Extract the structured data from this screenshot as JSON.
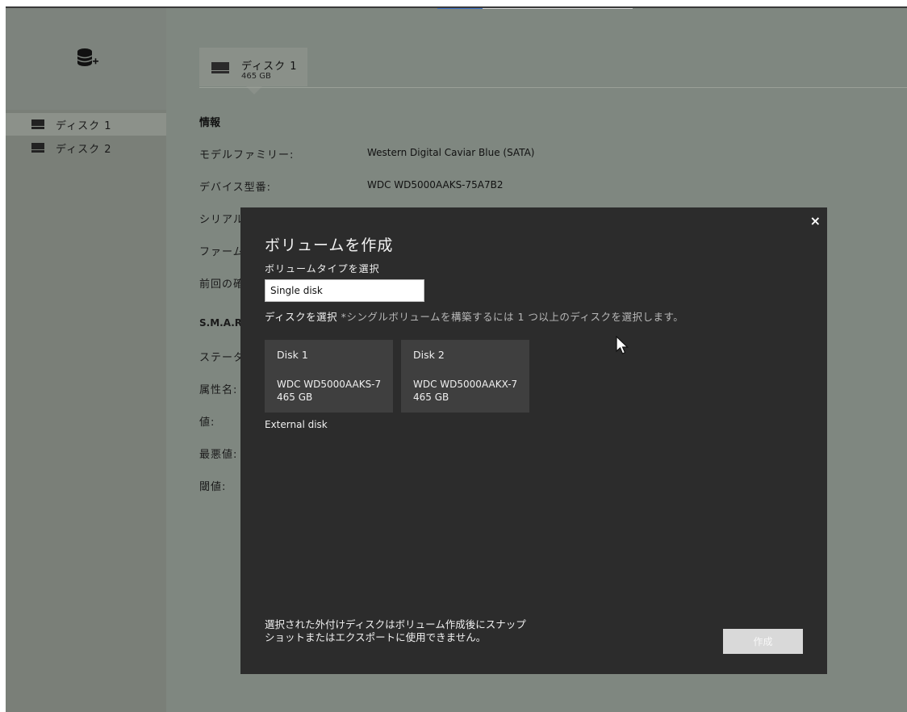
{
  "sidebar": {
    "add_icon": "database-add-icon",
    "items": [
      {
        "label": "ディスク 1",
        "active": true
      },
      {
        "label": "ディスク 2",
        "active": false
      }
    ]
  },
  "disk_tab": {
    "title": "ディスク 1",
    "size": "465 GB"
  },
  "info": {
    "heading": "情報",
    "rows": [
      {
        "label": "モデルファミリー:",
        "value": "Western Digital Caviar Blue (SATA)"
      },
      {
        "label": "デバイス型番:",
        "value": "WDC WD5000AAKS-75A7B2"
      },
      {
        "label": "シリアル",
        "value": ""
      },
      {
        "label": "ファーム",
        "value": ""
      },
      {
        "label": "前回の確",
        "value": ""
      }
    ],
    "smart_heading": "S.M.A.R.",
    "smart_rows": [
      {
        "label": "ステータ"
      },
      {
        "label": "属性名:"
      },
      {
        "label": "値:"
      },
      {
        "label": "最悪値:"
      },
      {
        "label": "閾値:"
      }
    ]
  },
  "dialog": {
    "title": "ボリュームを作成",
    "volume_type_label": "ボリュームタイプを選択",
    "volume_type_value": "Single disk",
    "select_disk_label": "ディスクを選択",
    "select_disk_hint": " *シングルボリュームを構築するには 1 つ以上のディスクを選択します。",
    "disks": [
      {
        "name": "Disk 1",
        "model": "WDC WD5000AAKS-7",
        "size": "465 GB"
      },
      {
        "name": "Disk 2",
        "model": "WDC WD5000AAKX-7",
        "size": "465 GB"
      }
    ],
    "external_disk_label": "External disk",
    "footer_note": "選択された外付けディスクはボリューム作成後にスナップ\nショットまたはエクスポートに使用できません。",
    "create_button": "作成",
    "close_symbol": "×"
  }
}
